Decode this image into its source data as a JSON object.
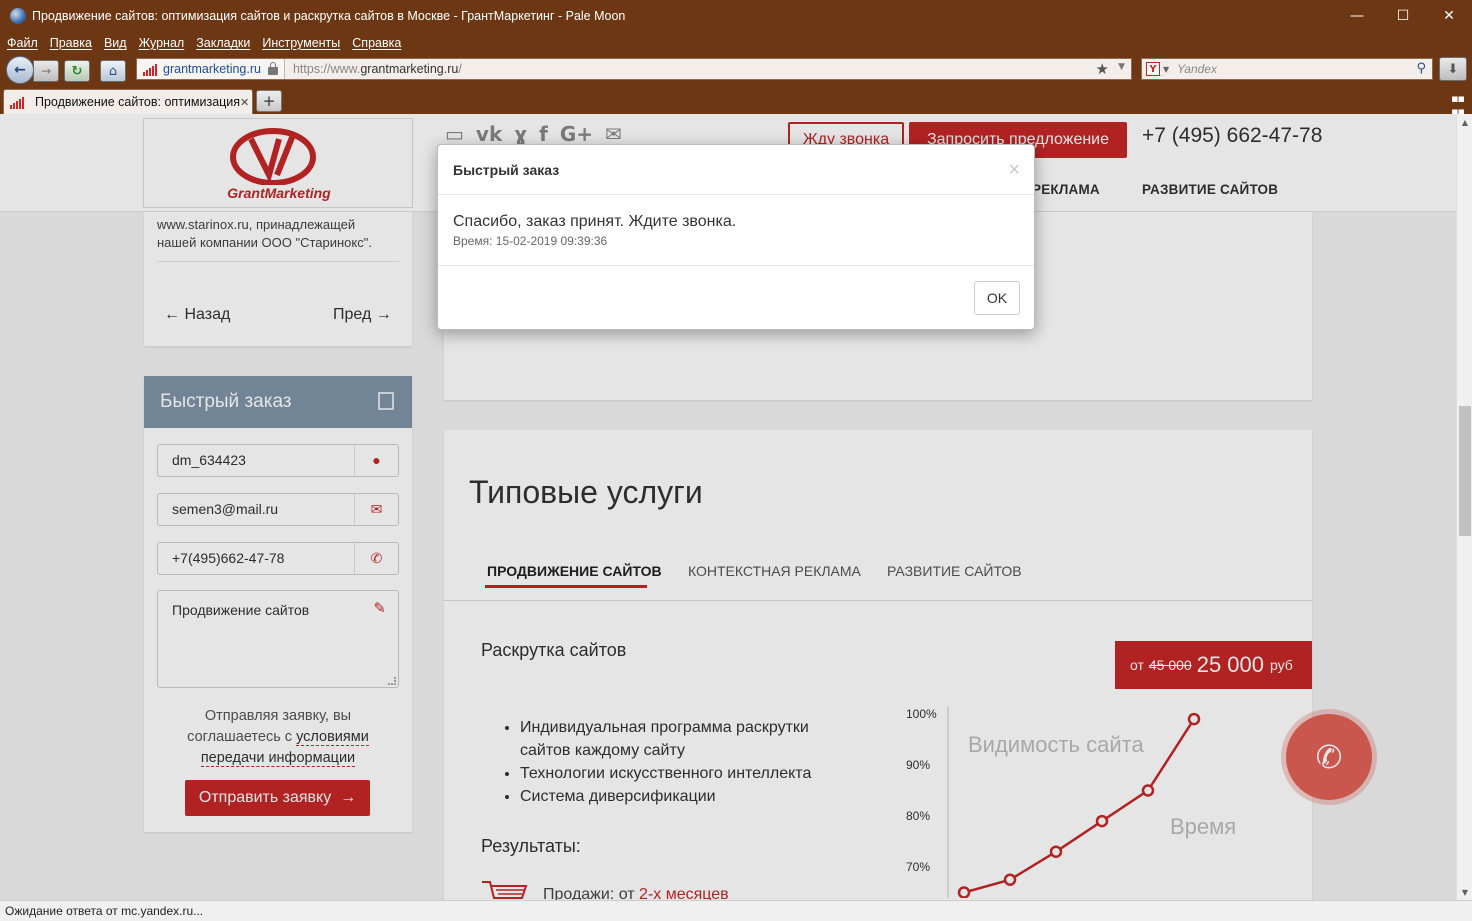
{
  "window": {
    "title": "Продвижение сайтов: оптимизация сайтов и раскрутка сайтов в Москве - ГрантМаркетинг - Pale Moon",
    "minimize": "—",
    "maximize": "☐",
    "close": "✕"
  },
  "menu": [
    "Файл",
    "Правка",
    "Вид",
    "Журнал",
    "Закладки",
    "Инструменты",
    "Справка"
  ],
  "nav": {
    "site_identity": "grantmarketing.ru",
    "url_prefix": "https://www.",
    "url_host": "grantmarketing.ru",
    "url_suffix": "/",
    "search_engine": "Y",
    "search_placeholder": "Yandex"
  },
  "tab": {
    "label": "Продвижение сайтов: оптимизация...",
    "close": "✕",
    "new": "+"
  },
  "status": "Ожидание ответа от mc.yandex.ru...",
  "header": {
    "logo_text": "GrantMarketing",
    "callback": "Жду звонка",
    "offer": "Запросить предложение",
    "phone": "+7 (495) 662-47-78",
    "nav_item_1": "РЕКЛАМА",
    "nav_item_2": "РАЗВИТИЕ САЙТОВ"
  },
  "sidebar": {
    "text": "www.starinox.ru, принадлежащей нашей компании ООО \"Старинокс\".",
    "prev": "Назад",
    "next": "Пред",
    "order_title": "Быстрый заказ",
    "name_value": "dm_634423",
    "email_value": "semen3@mail.ru",
    "phone_value": "+7(495)662-47-78",
    "message_value": "Продвижение сайтов",
    "agree_text_1": "Отправляя заявку, вы соглашаетесь с",
    "agree_link": "условиями передачи информации",
    "submit": "Отправить заявку"
  },
  "services": {
    "title": "Типовые услуги",
    "tabs": [
      "ПРОДВИЖЕНИЕ САЙТОВ",
      "КОНТЕКСТНАЯ РЕКЛАМА",
      "РАЗВИТИЕ САЙТОВ"
    ],
    "service_title": "Раскрутка сайтов",
    "price_from": "от",
    "price_old": "45 000",
    "price_new": "25 000",
    "price_currency": "руб",
    "bullets": [
      "Индивидуальная программа раскрутки сайтов каждому сайту",
      "Технологии искусственного интеллекта",
      "Система диверсификации"
    ],
    "results_title": "Результаты:",
    "sales_prefix": "Продажи: от",
    "sales_value": "2-х месяцев"
  },
  "chart_data": {
    "type": "line",
    "title": "Видимость сайта",
    "xlabel": "Время",
    "ylabel": "",
    "yticks": [
      "100%",
      "90%",
      "80%",
      "70%"
    ],
    "ylim": [
      60,
      100
    ],
    "x": [
      1,
      2,
      3,
      4,
      5,
      6
    ],
    "values": [
      65,
      67.5,
      73,
      79,
      85,
      99
    ],
    "line_color": "#c62828"
  },
  "modal": {
    "title": "Быстрый заказ",
    "close": "×",
    "message": "Спасибо, заказ принят. Ждите звонка.",
    "time": "Время: 15-02-2019 09:39:36",
    "ok": "OK"
  },
  "colors": {
    "brand_red": "#c62828",
    "chrome_brown": "#6e3714",
    "order_header": "#7f95a8"
  }
}
